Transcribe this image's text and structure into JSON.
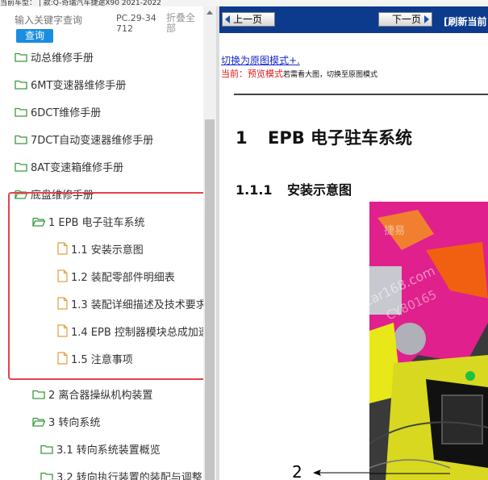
{
  "top_strip": {
    "text": "当前车型：  |  款:Q-奇瑞汽车捷途X90 2021-2022"
  },
  "left_panel": {
    "search_placeholder": "输入关键字查询",
    "query_button": "查询",
    "model_code": "PC.29-34712",
    "collapse_all": "折叠全部"
  },
  "tree": [
    {
      "label": "动总维修手册",
      "icon": "folder-icon"
    },
    {
      "label": "6MT变速器维修手册",
      "icon": "folder-icon"
    },
    {
      "label": "6DCT维修手册",
      "icon": "folder-icon"
    },
    {
      "label": "7DCT自动变速器维修手册",
      "icon": "folder-icon"
    },
    {
      "label": "8AT变速箱维修手册",
      "icon": "folder-icon"
    },
    {
      "label": "底盘维修手册",
      "icon": "folder-open-icon"
    },
    {
      "label": "1 EPB 电子驻车系统",
      "icon": "folder-open-icon"
    },
    {
      "label": "1.1 安装示意图",
      "icon": "document-icon"
    },
    {
      "label": "1.2 装配零部件明细表",
      "icon": "document-icon"
    },
    {
      "label": "1.3 装配详细描述及技术要求",
      "icon": "document-icon"
    },
    {
      "label": "1.4 EPB 控制器模块总成加速",
      "icon": "document-icon"
    },
    {
      "label": "1.5 注意事项",
      "icon": "document-icon"
    },
    {
      "label": "2 离合器操纵机构装置",
      "icon": "folder-icon"
    },
    {
      "label": "3 转向系统",
      "icon": "folder-open-icon"
    },
    {
      "label": "3.1 转向系统装置概览",
      "icon": "folder-icon"
    },
    {
      "label": "3.2 转向执行装置的装配与调整",
      "icon": "folder-icon"
    }
  ],
  "right_panel": {
    "prev_button": "上一页",
    "next_button": "下一页",
    "refresh_link": "[刷新当前",
    "switch_link": "切换为原图模式+.",
    "preview_prefix": "当前：",
    "preview_mode": "预览模式",
    "preview_hint": "若需看大图，切换至原图模式",
    "doc_title_num": "1",
    "doc_title_text": "EPB 电子驻车系统",
    "doc_sub_num": "1.1.1",
    "doc_sub_text": "安装示意图",
    "watermark_1": "捷易",
    "watermark_2": "car168.com",
    "watermark_3": "CY80165",
    "callout_label": "2"
  },
  "colors": {
    "navbar": "#0c3a8c",
    "query_button": "#1a8de0",
    "folder_icon": "#3a9a3a",
    "document_icon": "#e0a040",
    "highlight_border": "#e8404a",
    "preview_red": "#e01818",
    "link_blue": "#1a2bd0",
    "figure_magenta": "#e0208c",
    "figure_yellow": "#e8e818"
  }
}
